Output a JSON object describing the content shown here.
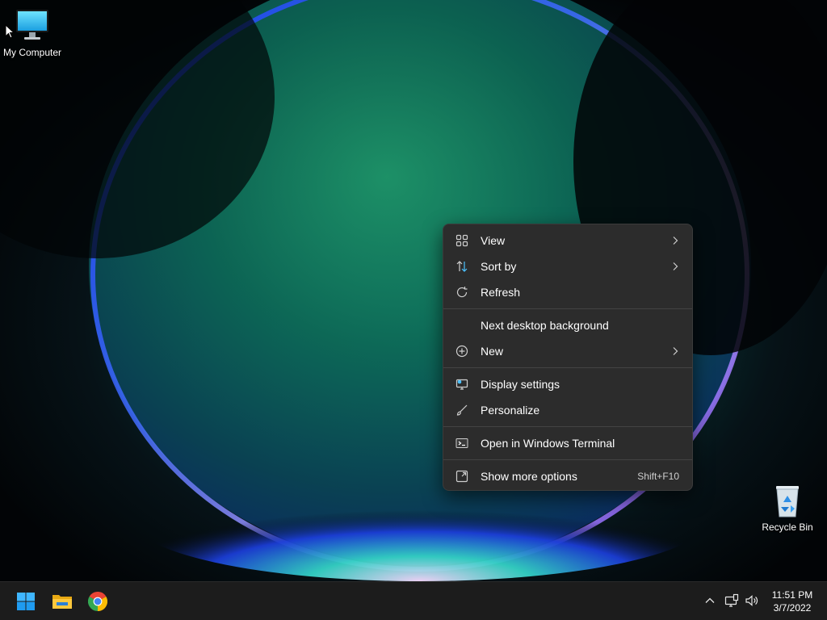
{
  "desktop": {
    "icons": [
      {
        "label": "My Computer",
        "icon": "monitor-icon"
      },
      {
        "label": "Recycle Bin",
        "icon": "recycle-bin-icon"
      }
    ]
  },
  "context_menu": {
    "items": [
      {
        "label": "View",
        "icon": "grid-icon",
        "submenu": true
      },
      {
        "label": "Sort by",
        "icon": "sort-icon",
        "submenu": true
      },
      {
        "label": "Refresh",
        "icon": "refresh-icon"
      },
      {
        "label": "Next desktop background",
        "icon": ""
      },
      {
        "label": "New",
        "icon": "plus-circle-icon",
        "submenu": true
      },
      {
        "label": "Display settings",
        "icon": "display-settings-icon"
      },
      {
        "label": "Personalize",
        "icon": "brush-icon"
      },
      {
        "label": "Open in Windows Terminal",
        "icon": "terminal-icon"
      },
      {
        "label": "Show more options",
        "icon": "expand-icon",
        "shortcut": "Shift+F10"
      }
    ]
  },
  "taskbar": {
    "apps": [
      {
        "name": "Start",
        "icon": "windows-logo-icon"
      },
      {
        "name": "File Explorer",
        "icon": "folder-icon"
      },
      {
        "name": "Google Chrome",
        "icon": "chrome-icon"
      }
    ],
    "tray": {
      "icons": [
        "chevron-up-icon",
        "network-icon",
        "volume-icon"
      ],
      "time": "11:51 PM",
      "date": "3/7/2022"
    }
  },
  "colors": {
    "menu_background": "#2c2c2c",
    "taskbar_background": "#1c1c1c",
    "accent_blue": "#4cc2ff"
  }
}
